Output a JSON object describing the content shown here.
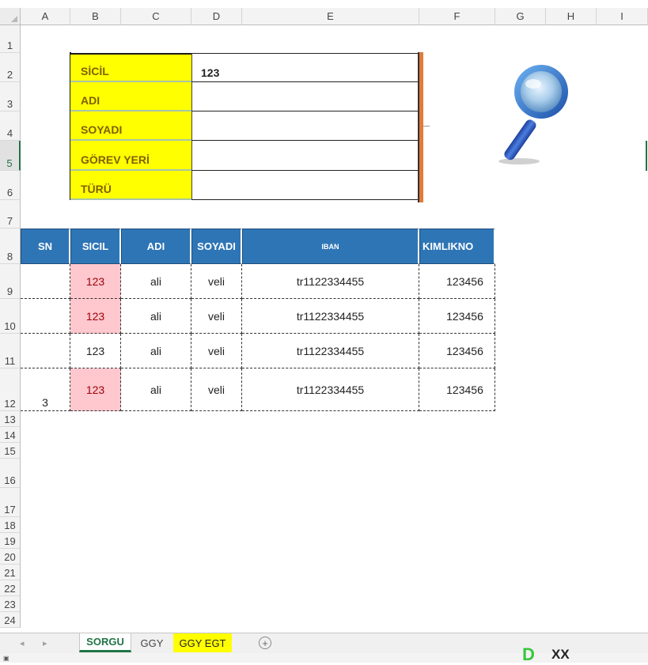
{
  "columns": [
    "A",
    "B",
    "C",
    "D",
    "E",
    "F",
    "G",
    "H",
    "I"
  ],
  "rows": [
    "1",
    "2",
    "3",
    "4",
    "5",
    "6",
    "7",
    "8",
    "9",
    "10",
    "11",
    "12",
    "13",
    "14",
    "15",
    "16",
    "17",
    "18",
    "19",
    "20",
    "21",
    "22",
    "23",
    "24"
  ],
  "form": {
    "labels": [
      "SİCİL",
      "ADI",
      "SOYADI",
      "GÖREV YERİ",
      "TÜRÜ"
    ],
    "values": [
      "123",
      "",
      "",
      "",
      ""
    ]
  },
  "table": {
    "headers": [
      "SN",
      "SICIL",
      "ADI",
      "SOYADI",
      "IBAN",
      "KIMLIKNO"
    ],
    "rows": [
      {
        "sn": "",
        "sicil": "123",
        "adi": "ali",
        "soyadi": "veli",
        "iban": "tr1122334455",
        "kimlik": "123456"
      },
      {
        "sn": "",
        "sicil": "123",
        "adi": "ali",
        "soyadi": "veli",
        "iban": "tr1122334455",
        "kimlik": "123456"
      },
      {
        "sn": "",
        "sicil": "123",
        "adi": "ali",
        "soyadi": "veli",
        "iban": "tr1122334455",
        "kimlik": "123456"
      },
      {
        "sn": "3",
        "sicil": "123",
        "adi": "ali",
        "soyadi": "veli",
        "iban": "tr1122334455",
        "kimlik": "123456"
      }
    ]
  },
  "icons": {
    "search": "magnifier-icon",
    "add_sheet": "plus-circle-icon"
  },
  "colors": {
    "label_bg": "#ffff00",
    "header_bg": "#2e75b6",
    "highlight": "#ffc7ce",
    "accent": "#217346",
    "orange": "#e07b3a"
  },
  "tabs": [
    "SORGU",
    "GGY",
    "GGY EGT"
  ],
  "active_tab": "SORGU",
  "watermark": {
    "brand": "D",
    "text": "XX"
  }
}
